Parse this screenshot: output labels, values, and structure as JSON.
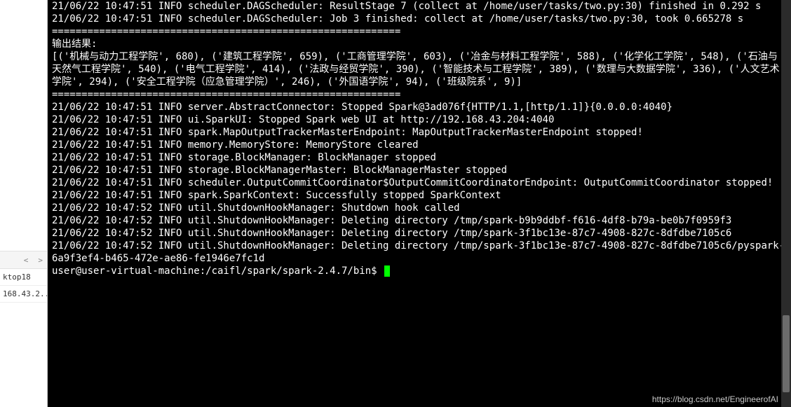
{
  "side": {
    "nav_prev": "<",
    "nav_next": ">",
    "items": [
      "ktop18",
      "168.43.2..."
    ]
  },
  "terminal": {
    "lines": [
      "21/06/22 10:47:51 INFO scheduler.DAGScheduler: ResultStage 7 (collect at /home/user/tasks/two.py:30) finished in 0.292 s",
      "21/06/22 10:47:51 INFO scheduler.DAGScheduler: Job 3 finished: collect at /home/user/tasks/two.py:30, took 0.665278 s",
      "===========================================================",
      "输出结果:",
      "[('机械与动力工程学院', 680), ('建筑工程学院', 659), ('工商管理学院', 603), ('冶金与材料工程学院', 588), ('化学化工学院', 548), ('石油与天然气工程学院', 540), ('电气工程学院', 414), ('法政与经贸学院', 390), ('智能技术与工程学院', 389), ('数理与大数据学院', 336), ('人文艺术学院', 294), ('安全工程学院（应急管理学院）', 246), ('外国语学院', 94), ('班级院系', 9)]",
      "===========================================================",
      "21/06/22 10:47:51 INFO server.AbstractConnector: Stopped Spark@3ad076f{HTTP/1.1,[http/1.1]}{0.0.0.0:4040}",
      "21/06/22 10:47:51 INFO ui.SparkUI: Stopped Spark web UI at http://192.168.43.204:4040",
      "21/06/22 10:47:51 INFO spark.MapOutputTrackerMasterEndpoint: MapOutputTrackerMasterEndpoint stopped!",
      "21/06/22 10:47:51 INFO memory.MemoryStore: MemoryStore cleared",
      "21/06/22 10:47:51 INFO storage.BlockManager: BlockManager stopped",
      "21/06/22 10:47:51 INFO storage.BlockManagerMaster: BlockManagerMaster stopped",
      "21/06/22 10:47:51 INFO scheduler.OutputCommitCoordinator$OutputCommitCoordinatorEndpoint: OutputCommitCoordinator stopped!",
      "21/06/22 10:47:51 INFO spark.SparkContext: Successfully stopped SparkContext",
      "21/06/22 10:47:52 INFO util.ShutdownHookManager: Shutdown hook called",
      "21/06/22 10:47:52 INFO util.ShutdownHookManager: Deleting directory /tmp/spark-b9b9ddbf-f616-4df8-b79a-be0b7f0959f3",
      "21/06/22 10:47:52 INFO util.ShutdownHookManager: Deleting directory /tmp/spark-3f1bc13e-87c7-4908-827c-8dfdbe7105c6",
      "21/06/22 10:47:52 INFO util.ShutdownHookManager: Deleting directory /tmp/spark-3f1bc13e-87c7-4908-827c-8dfdbe7105c6/pyspark-6a9f3ef4-b465-472e-ae86-fe1946e7fc1d"
    ],
    "prompt": "user@user-virtual-machine:/caifl/spark/spark-2.4.7/bin$ "
  },
  "watermark": "https://blog.csdn.net/EngineerofAI"
}
